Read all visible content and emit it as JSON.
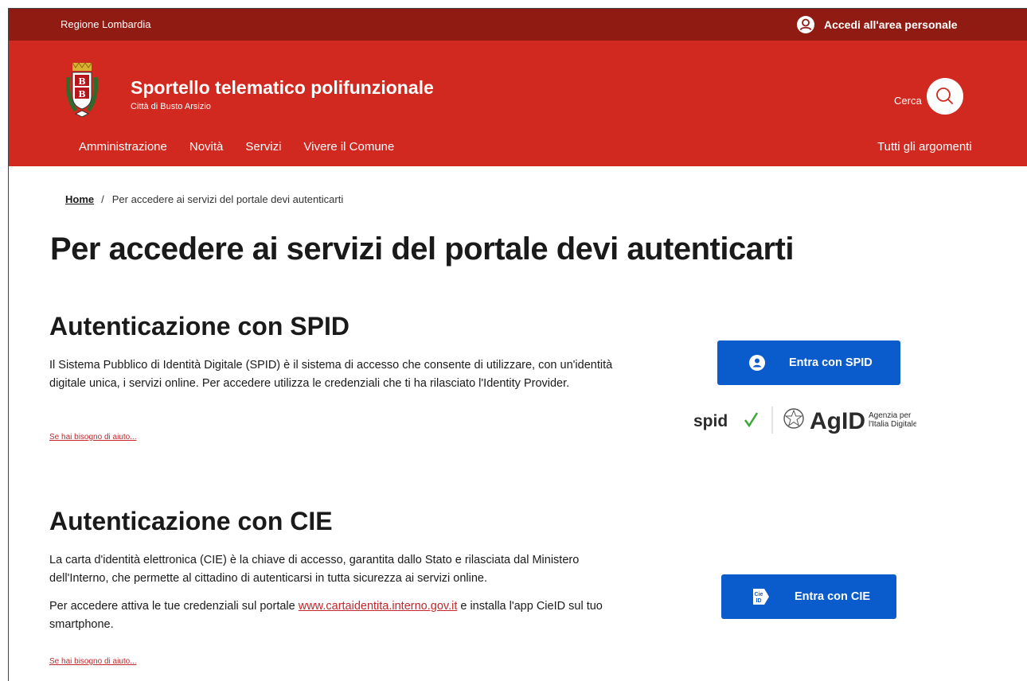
{
  "topbar": {
    "region": "Regione Lombardia",
    "login_label": "Accedi all'area personale",
    "login_icon": "user-circle-icon"
  },
  "header": {
    "title": "Sportello telematico polifunzionale",
    "subtitle": "Città di Busto Arsizio",
    "search_label": "Cerca",
    "search_icon": "search-icon"
  },
  "nav": {
    "items": [
      {
        "label": "Amministrazione"
      },
      {
        "label": "Novità"
      },
      {
        "label": "Servizi"
      },
      {
        "label": "Vivere il Comune"
      }
    ],
    "right_label": "Tutti gli argomenti"
  },
  "breadcrumb": {
    "home": "Home",
    "separator": "/",
    "current": "Per accedere ai servizi del portale devi autenticarti"
  },
  "page": {
    "title": "Per accedere ai servizi del portale devi autenticarti"
  },
  "spid": {
    "title": "Autenticazione con SPID",
    "paragraph": "Il Sistema Pubblico di Identità Digitale (SPID) è il sistema di accesso che consente di utilizzare, con un'identità digitale unica, i servizi online. Per accedere utilizza le credenziali che ti ha rilasciato l'Identity Provider.",
    "help_link": "Se hai bisogno di aiuto...",
    "button_label": "Entra con SPID",
    "logo_spid": "spid",
    "logo_agid": "AgID",
    "logo_agid_caption_1": "Agenzia per",
    "logo_agid_caption_2": "l'Italia Digitale"
  },
  "cie": {
    "title": "Autenticazione con CIE",
    "paragraph_1": "La carta d'identità elettronica (CIE) è la chiave di accesso, garantita dallo Stato e rilasciata dal Ministero dell'Interno, che permette al cittadino di autenticarsi in tutta sicurezza ai servizi online.",
    "paragraph_2_before": "Per accedere attiva le tue credenziali sul portale ",
    "paragraph_2_link": "www.cartaidentita.interno.gov.it",
    "paragraph_2_after": " e installa l'app CieID sul tuo smartphone.",
    "help_link": "Se hai bisogno di aiuto...",
    "button_label": "Entra con CIE",
    "button_icon_text": "Cie ID"
  },
  "colors": {
    "topbar": "#8f1b13",
    "header": "#d1281f",
    "button": "#0a5ccc",
    "link": "#c1272d"
  }
}
